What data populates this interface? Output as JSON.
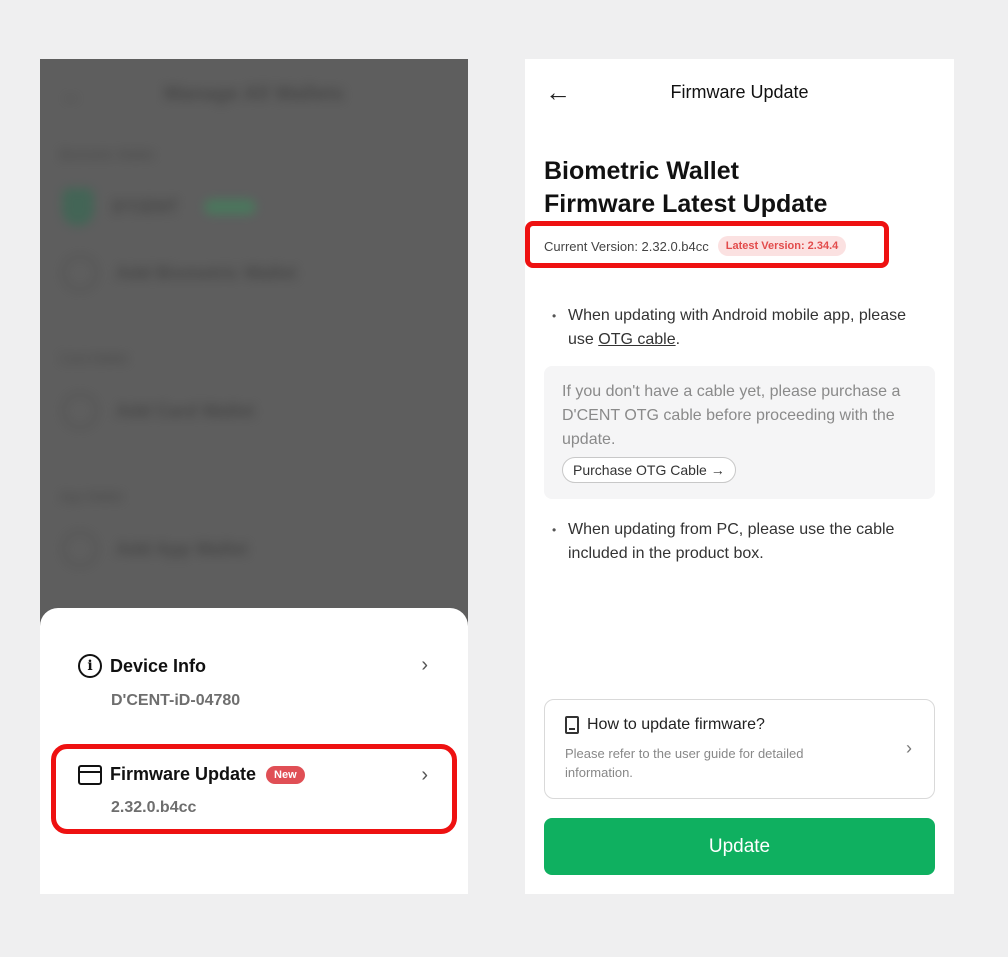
{
  "left": {
    "background_screen": {
      "title": "Manage All Wallets",
      "section_1": "Biometric Wallet",
      "wallet_name": "D'CENT",
      "add_biometric": "Add Biometric Wallet",
      "section_2": "Card Wallet",
      "add_card": "Add Card Wallet",
      "section_3": "App Wallet",
      "add_app": "Add App Wallet"
    },
    "sheet": {
      "device_info": {
        "label": "Device Info",
        "value": "D'CENT-iD-04780"
      },
      "firmware_update": {
        "label": "Firmware Update",
        "badge": "New",
        "value": "2.32.0.b4cc"
      }
    }
  },
  "right": {
    "header_title": "Firmware Update",
    "title_line1": "Biometric Wallet",
    "title_line2": "Firmware Latest Update",
    "current_version": "Current Version: 2.32.0.b4cc",
    "latest_version": "Latest Version: 2.34.4",
    "bullet1_prefix": "When updating with Android mobile app, please use ",
    "bullet1_link": "OTG cable",
    "bullet1_suffix": ".",
    "cable_note": "If you don't have a cable yet, please purchase a D'CENT OTG cable before proceeding with the update.",
    "purchase_button": "Purchase OTG Cable →",
    "bullet2": "When updating from PC, please use the cable included in the product box.",
    "guide_title": "How to update firmware?",
    "guide_text": "Please refer to the user guide for detailed information.",
    "update_button": "Update"
  },
  "colors": {
    "accent_green": "#0fb060",
    "badge_red": "#e04f55",
    "highlight_red": "#ee1111"
  }
}
